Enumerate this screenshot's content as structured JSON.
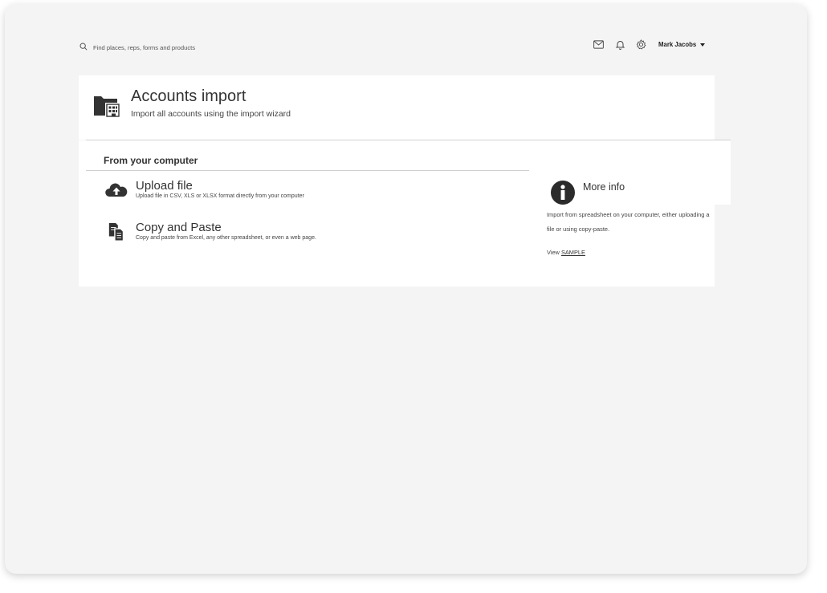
{
  "topbar": {
    "search_placeholder": "Find places, reps, forms and products",
    "icons": [
      "search-icon",
      "mail-icon",
      "bell-icon",
      "gear-icon"
    ],
    "user_name": "Mark Jacobs"
  },
  "header": {
    "title": "Accounts import",
    "subtitle": "Import all accounts using the import wizard",
    "icon": "folder-building-icon"
  },
  "section": {
    "title": "From your computer",
    "options": [
      {
        "icon": "cloud-upload-icon",
        "title": "Upload file",
        "description": "Upload file in CSV, XLS or XLSX format directly from your computer"
      },
      {
        "icon": "copy-paste-icon",
        "title": "Copy and Paste",
        "description": "Copy and paste from Excel, any other spreadsheet, or even a web page."
      }
    ]
  },
  "more_info": {
    "title": "More info",
    "icon": "info-icon",
    "text": "Import from spreadsheet on your computer, either uploading a file or using copy-paste.",
    "view_prefix": "View",
    "view_link": "SAMPLE"
  },
  "colors": {
    "background": "#f4f4f4",
    "card": "#ffffff",
    "icon_dark": "#333333",
    "text": "#333333"
  }
}
